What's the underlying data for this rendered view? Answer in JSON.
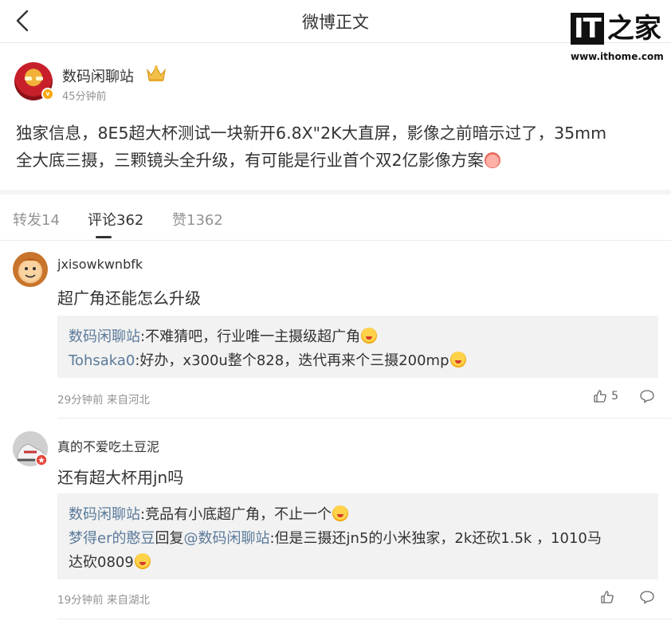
{
  "header": {
    "title": "微博正文",
    "watermark_logo_text": "IT之家",
    "watermark_url": "www.ithome.com"
  },
  "author": {
    "name": "数码闲聊站",
    "time": "45分钟前",
    "verified_color": "#f7a70a"
  },
  "post": {
    "line1": "独家信息，8E5超大杯测试一块新开6.8X\"2K大直屏，影像之前暗示过了，35mm",
    "line2": "全大底三摄，三颗镜头全升级，有可能是行业首个双2亿影像方案"
  },
  "tabs": [
    {
      "label": "转发14",
      "active": false
    },
    {
      "label": "评论362",
      "active": true
    },
    {
      "label": "赞1362",
      "active": false
    }
  ],
  "comments": [
    {
      "user": "jxisowkwnbfk",
      "text": "超广角还能怎么升级",
      "replies": [
        {
          "user": "数码闲聊站",
          "text": ":不难猜吧，行业唯一主摄级超广角"
        },
        {
          "user": "Tohsaka0",
          "text": ":好办，x300u整个828，迭代再来个三摄200mp"
        }
      ],
      "meta": "29分钟前 来自河北",
      "likes": "5"
    },
    {
      "user": "真的不爱吃土豆泥",
      "text": "还有超大杯用jn吗",
      "replies": [
        {
          "user": "数码闲聊站",
          "text": ":竞品有小底超广角，不止一个"
        },
        {
          "user": "梦得er的憨豆",
          "reply_word": "回复",
          "mention": "@数码闲聊站",
          "text_line1": ":但是三摄还jn5的小米独家，2k还砍1.5k ，1010马",
          "text_line2": "达砍0809"
        }
      ],
      "meta": "19分钟前 来自湖北",
      "likes": ""
    }
  ],
  "colors": {
    "link": "#5b7a9a",
    "muted": "#939393",
    "reply_bg": "#f2f2f2"
  }
}
